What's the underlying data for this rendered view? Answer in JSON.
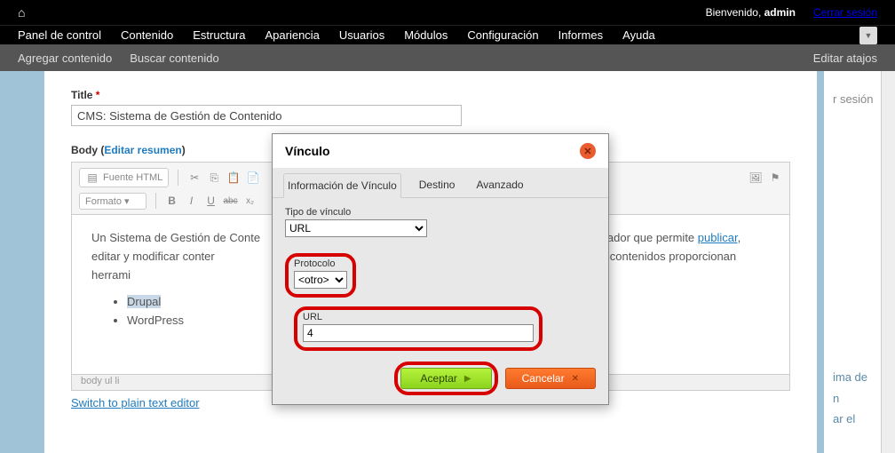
{
  "topbar": {
    "welcome_prefix": "Bienvenido, ",
    "welcome_user": "admin",
    "logout": "Cerrar sesión"
  },
  "menu": {
    "items": [
      "Panel de control",
      "Contenido",
      "Estructura",
      "Apariencia",
      "Usuarios",
      "Módulos",
      "Configuración",
      "Informes",
      "Ayuda"
    ]
  },
  "submenu": {
    "add": "Agregar contenido",
    "search": "Buscar contenido",
    "edit": "Editar atajos"
  },
  "form": {
    "title_label": "Title",
    "title_value": "CMS: Sistema de Gestión de Contenido",
    "body_label": "Body",
    "edit_summary": "Editar resumen",
    "source_btn": "Fuente HTML",
    "format_select": "Formato",
    "content_p1": "Un Sistema de Gestión de Contenido, es un programa de ordenador que permite publicar, editar y modificar contenido. Estos sistemas de gestión de contenidos proporcionan herramientas de forma manual o automatizada.",
    "list_item1": "Drupal",
    "list_item2": "WordPress",
    "status_path": "body  ul  li",
    "switch_link": "Switch to plain text editor"
  },
  "side": {
    "line1": "r sesión",
    "line2": "ima de",
    "line3": "n",
    "line4": "ar el"
  },
  "dialog": {
    "title": "Vínculo",
    "tabs": {
      "info": "Información de Vínculo",
      "dest": "Destino",
      "adv": "Avanzado"
    },
    "type_label": "Tipo de vínculo",
    "type_value": "URL",
    "protocol_label": "Protocolo",
    "protocol_value": "<otro>",
    "url_label": "URL",
    "url_value": "4",
    "accept": "Aceptar",
    "cancel": "Cancelar"
  }
}
